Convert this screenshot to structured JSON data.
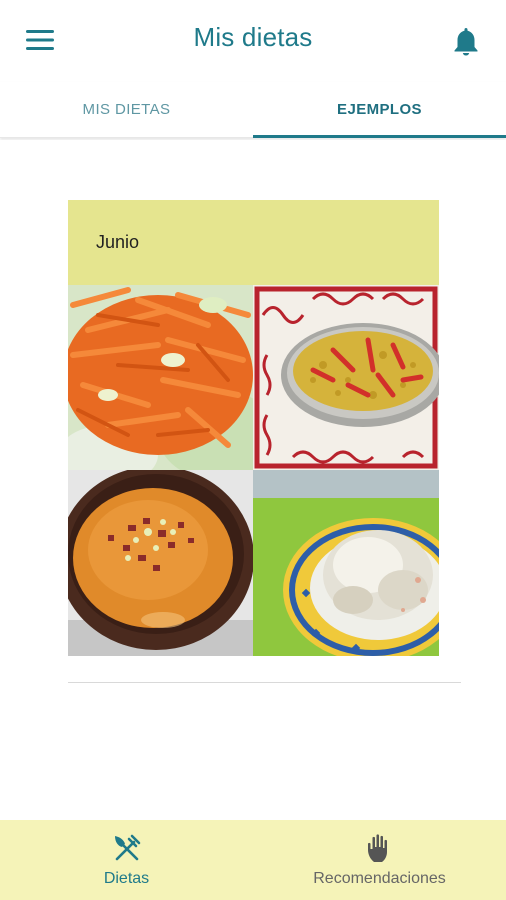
{
  "appbar": {
    "title": "Mis dietas",
    "menu_icon": "hamburger-menu-icon",
    "notification_icon": "bell-icon"
  },
  "tabs": [
    {
      "label": "MIS DIETAS",
      "active": false
    },
    {
      "label": "EJEMPLOS",
      "active": true
    }
  ],
  "card": {
    "title": "Junio",
    "images": [
      {
        "subject": "carrot salad"
      },
      {
        "subject": "rice with red peppers"
      },
      {
        "subject": "salmorejo soup"
      },
      {
        "subject": "fish with white sauce"
      }
    ]
  },
  "bottom_nav": {
    "items": [
      {
        "label": "Dietas",
        "icon": "fork-knife-icon",
        "active": true
      },
      {
        "label": "Recomendaciones",
        "icon": "hand-icon",
        "active": false
      }
    ]
  },
  "colors": {
    "primary": "#1f7a8a",
    "card_header": "#e5e58f",
    "bottom_nav_bg": "#f5f3b8"
  }
}
